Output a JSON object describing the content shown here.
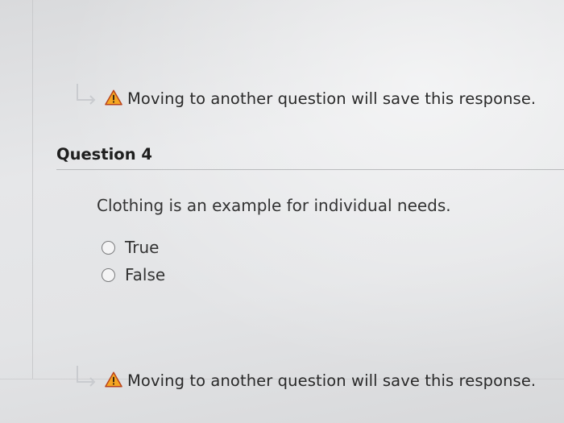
{
  "colors": {
    "warning_fill": "#f5a623",
    "warning_stroke": "#b9421b",
    "text": "#2b2b2b",
    "arrow": "#c9cbcf"
  },
  "top_notice": {
    "icon": "warning-triangle",
    "text": "Moving to another question will save this response."
  },
  "question": {
    "title": "Question 4",
    "text": "Clothing is an example for individual needs.",
    "options": [
      {
        "label": "True",
        "selected": false
      },
      {
        "label": "False",
        "selected": false
      }
    ]
  },
  "bottom_notice": {
    "icon": "warning-triangle",
    "text": "Moving to another question will save this response."
  }
}
